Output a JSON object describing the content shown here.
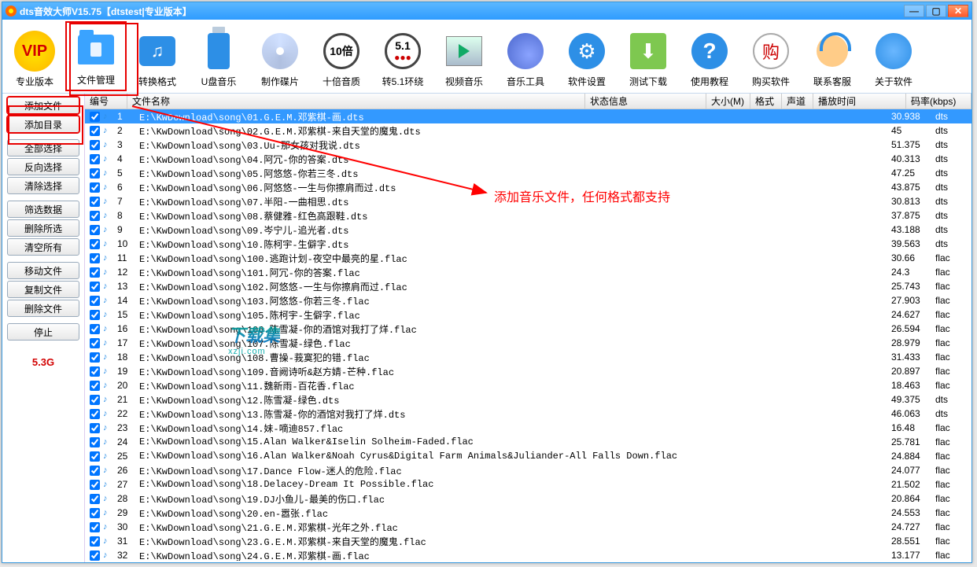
{
  "window": {
    "title": "dts音效大师V15.75【dtstest|专业版本】"
  },
  "toolbar": [
    {
      "name": "vip",
      "label": "专业版本"
    },
    {
      "name": "file-mgr",
      "label": "文件管理"
    },
    {
      "name": "convert",
      "label": "转换格式"
    },
    {
      "name": "usb",
      "label": "U盘音乐"
    },
    {
      "name": "disc",
      "label": "制作碟片"
    },
    {
      "name": "x10",
      "label": "十倍音质",
      "badge": "10倍"
    },
    {
      "name": "surround",
      "label": "转5.1环绕",
      "badge": "5.1"
    },
    {
      "name": "video",
      "label": "视频音乐"
    },
    {
      "name": "tools",
      "label": "音乐工具"
    },
    {
      "name": "settings",
      "label": "软件设置"
    },
    {
      "name": "testdl",
      "label": "测试下载"
    },
    {
      "name": "tutorial",
      "label": "使用教程"
    },
    {
      "name": "buy",
      "label": "购买软件",
      "badge": "购"
    },
    {
      "name": "support",
      "label": "联系客服"
    },
    {
      "name": "about",
      "label": "关于软件"
    }
  ],
  "sidebar": {
    "add_file": "添加文件",
    "add_dir": "添加目录",
    "sel_all": "全部选择",
    "sel_inv": "反向选择",
    "sel_clear": "清除选择",
    "filter": "筛选数据",
    "del_sel": "删除所选",
    "clear_all": "清空所有",
    "move": "移动文件",
    "copy": "复制文件",
    "del_file": "删除文件",
    "stop": "停止",
    "storage": "5.3G"
  },
  "columns": {
    "idx": "编号",
    "name": "文件名称",
    "status": "状态信息",
    "size": "大小(M)",
    "fmt": "格式",
    "ch": "声道",
    "time": "播放时间",
    "rate": "码率(kbps)"
  },
  "rows": [
    {
      "n": 1,
      "name": "E:\\KwDownload\\song\\01.G.E.M.邓紫棋-画.dts",
      "size": "30.938",
      "fmt": "dts",
      "sel": true
    },
    {
      "n": 2,
      "name": "E:\\KwDownload\\song\\02.G.E.M.邓紫棋-来自天堂的魔鬼.dts",
      "size": "45",
      "fmt": "dts"
    },
    {
      "n": 3,
      "name": "E:\\KwDownload\\song\\03.Uu-那女孩对我说.dts",
      "size": "51.375",
      "fmt": "dts"
    },
    {
      "n": 4,
      "name": "E:\\KwDownload\\song\\04.阿冗-你的答案.dts",
      "size": "40.313",
      "fmt": "dts"
    },
    {
      "n": 5,
      "name": "E:\\KwDownload\\song\\05.阿悠悠-你若三冬.dts",
      "size": "47.25",
      "fmt": "dts"
    },
    {
      "n": 6,
      "name": "E:\\KwDownload\\song\\06.阿悠悠-一生与你擦肩而过.dts",
      "size": "43.875",
      "fmt": "dts"
    },
    {
      "n": 7,
      "name": "E:\\KwDownload\\song\\07.半阳-一曲相思.dts",
      "size": "30.813",
      "fmt": "dts"
    },
    {
      "n": 8,
      "name": "E:\\KwDownload\\song\\08.蔡健雅-红色高跟鞋.dts",
      "size": "37.875",
      "fmt": "dts"
    },
    {
      "n": 9,
      "name": "E:\\KwDownload\\song\\09.岑宁儿-追光者.dts",
      "size": "43.188",
      "fmt": "dts"
    },
    {
      "n": 10,
      "name": "E:\\KwDownload\\song\\10.陈柯宇-生僻字.dts",
      "size": "39.563",
      "fmt": "dts"
    },
    {
      "n": 11,
      "name": "E:\\KwDownload\\song\\100.逃跑计划-夜空中最亮的星.flac",
      "size": "30.66",
      "fmt": "flac"
    },
    {
      "n": 12,
      "name": "E:\\KwDownload\\song\\101.阿冗-你的答案.flac",
      "size": "24.3",
      "fmt": "flac"
    },
    {
      "n": 13,
      "name": "E:\\KwDownload\\song\\102.阿悠悠-一生与你擦肩而过.flac",
      "size": "25.743",
      "fmt": "flac"
    },
    {
      "n": 14,
      "name": "E:\\KwDownload\\song\\103.阿悠悠-你若三冬.flac",
      "size": "27.903",
      "fmt": "flac"
    },
    {
      "n": 15,
      "name": "E:\\KwDownload\\song\\105.陈柯宇-生僻字.flac",
      "size": "24.627",
      "fmt": "flac"
    },
    {
      "n": 16,
      "name": "E:\\KwDownload\\song\\106.陈雪凝-你的酒馆对我打了烊.flac",
      "size": "26.594",
      "fmt": "flac"
    },
    {
      "n": 17,
      "name": "E:\\KwDownload\\song\\107.陈雪凝-绿色.flac",
      "size": "28.979",
      "fmt": "flac"
    },
    {
      "n": 18,
      "name": "E:\\KwDownload\\song\\108.曹操-莪寞犯的错.flac",
      "size": "31.433",
      "fmt": "flac"
    },
    {
      "n": 19,
      "name": "E:\\KwDownload\\song\\109.音阙诗听&赵方婧-芒种.flac",
      "size": "20.897",
      "fmt": "flac"
    },
    {
      "n": 20,
      "name": "E:\\KwDownload\\song\\11.魏新雨-百花香.flac",
      "size": "18.463",
      "fmt": "flac"
    },
    {
      "n": 21,
      "name": "E:\\KwDownload\\song\\12.陈雪凝-绿色.dts",
      "size": "49.375",
      "fmt": "dts"
    },
    {
      "n": 22,
      "name": "E:\\KwDownload\\song\\13.陈雪凝-你的酒馆对我打了烊.dts",
      "size": "46.063",
      "fmt": "dts"
    },
    {
      "n": 23,
      "name": "E:\\KwDownload\\song\\14.妹-嘀迪857.flac",
      "size": "16.48",
      "fmt": "flac"
    },
    {
      "n": 24,
      "name": "E:\\KwDownload\\song\\15.Alan Walker&Iselin Solheim-Faded.flac",
      "size": "25.781",
      "fmt": "flac"
    },
    {
      "n": 25,
      "name": "E:\\KwDownload\\song\\16.Alan Walker&Noah Cyrus&Digital Farm Animals&Juliander-All Falls Down.flac",
      "size": "24.884",
      "fmt": "flac"
    },
    {
      "n": 26,
      "name": "E:\\KwDownload\\song\\17.Dance Flow-迷人的危险.flac",
      "size": "24.077",
      "fmt": "flac"
    },
    {
      "n": 27,
      "name": "E:\\KwDownload\\song\\18.Delacey-Dream It Possible.flac",
      "size": "21.502",
      "fmt": "flac"
    },
    {
      "n": 28,
      "name": "E:\\KwDownload\\song\\19.DJ小鱼儿-最美的伤口.flac",
      "size": "20.864",
      "fmt": "flac"
    },
    {
      "n": 29,
      "name": "E:\\KwDownload\\song\\20.en-嚣张.flac",
      "size": "24.553",
      "fmt": "flac"
    },
    {
      "n": 30,
      "name": "E:\\KwDownload\\song\\21.G.E.M.邓紫棋-光年之外.flac",
      "size": "24.727",
      "fmt": "flac"
    },
    {
      "n": 31,
      "name": "E:\\KwDownload\\song\\23.G.E.M.邓紫棋-来自天堂的魔鬼.flac",
      "size": "28.551",
      "fmt": "flac"
    },
    {
      "n": 32,
      "name": "E:\\KwDownload\\song\\24.G.E.M.邓紫棋-画.flac",
      "size": "13.177",
      "fmt": "flac"
    }
  ],
  "annotation": "添加音乐文件，任何格式都支持",
  "watermark": {
    "text": "下载集",
    "url": "xzji.com"
  }
}
